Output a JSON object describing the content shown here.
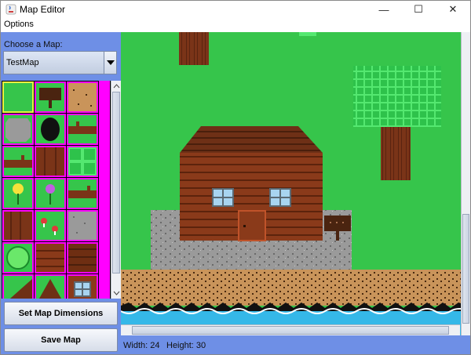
{
  "window": {
    "title": "Map Editor",
    "minimize": "—",
    "maximize": "☐",
    "close": "✕"
  },
  "menu": {
    "options": "Options"
  },
  "sidebar": {
    "choose_label": "Choose a Map:",
    "map_select": {
      "value": "TestMap"
    },
    "set_dimensions_button": "Set Map Dimensions",
    "save_button": "Save Map"
  },
  "status": {
    "width": "Width: 24",
    "height": "Height: 30"
  },
  "colors": {
    "accent": "#6e8fe6",
    "grass": "#36c54b",
    "palette_border": "#ff00ff",
    "selected_border": "#e9f240",
    "water": "#35b8e8",
    "dirt": "#c9945a",
    "wood": "#8a3a1a"
  },
  "palette_tiles": [
    "grass-tile",
    "sign-tile",
    "dirt-tile",
    "rock-tile",
    "hole-tile",
    "log-tile",
    "stump-tile",
    "tree-trunk-tile",
    "tree-leaves-tile",
    "yellow-flower-tile",
    "purple-flower-tile",
    "log-end-tile",
    "trunk-bark-tile",
    "mushroom-tile",
    "stone-path-tile",
    "bush-tile",
    "floor-plank-tile",
    "wall-plank-tile",
    "grass-slope-tile",
    "roof-tile",
    "window-tile"
  ]
}
